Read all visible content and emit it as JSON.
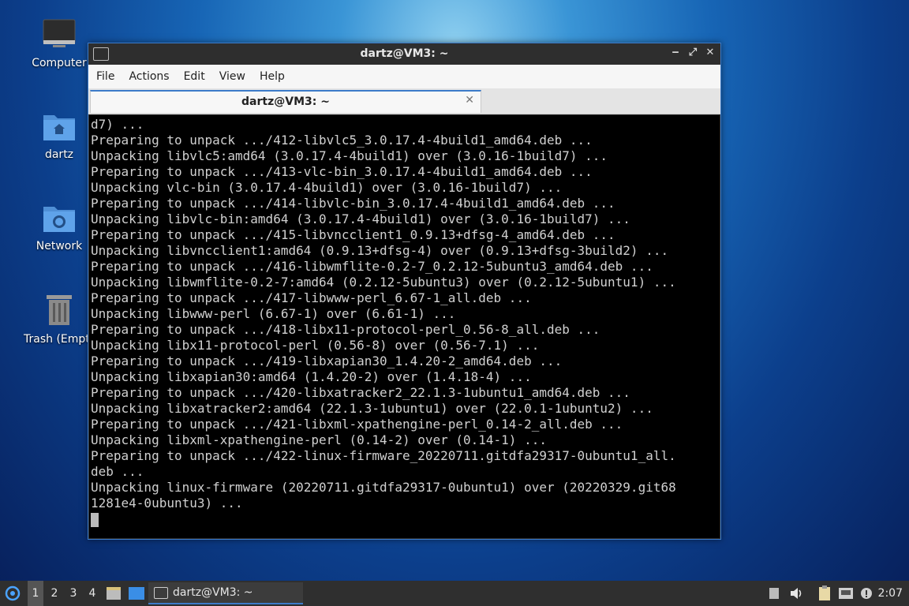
{
  "desktop": {
    "icons": [
      {
        "label": "Computer"
      },
      {
        "label": "dartz"
      },
      {
        "label": "Network"
      },
      {
        "label": "Trash (Empty)"
      }
    ]
  },
  "window": {
    "title": "dartz@VM3: ~",
    "menu": [
      "File",
      "Actions",
      "Edit",
      "View",
      "Help"
    ],
    "tab_label": "dartz@VM3: ~",
    "controls": {
      "minimize": "‒",
      "maximize": "⤢",
      "close": "✕"
    }
  },
  "terminal": {
    "lines": [
      "d7) ...",
      "Preparing to unpack .../412-libvlc5_3.0.17.4-4build1_amd64.deb ...",
      "Unpacking libvlc5:amd64 (3.0.17.4-4build1) over (3.0.16-1build7) ...",
      "Preparing to unpack .../413-vlc-bin_3.0.17.4-4build1_amd64.deb ...",
      "Unpacking vlc-bin (3.0.17.4-4build1) over (3.0.16-1build7) ...",
      "Preparing to unpack .../414-libvlc-bin_3.0.17.4-4build1_amd64.deb ...",
      "Unpacking libvlc-bin:amd64 (3.0.17.4-4build1) over (3.0.16-1build7) ...",
      "Preparing to unpack .../415-libvncclient1_0.9.13+dfsg-4_amd64.deb ...",
      "Unpacking libvncclient1:amd64 (0.9.13+dfsg-4) over (0.9.13+dfsg-3build2) ...",
      "Preparing to unpack .../416-libwmflite-0.2-7_0.2.12-5ubuntu3_amd64.deb ...",
      "Unpacking libwmflite-0.2-7:amd64 (0.2.12-5ubuntu3) over (0.2.12-5ubuntu1) ...",
      "Preparing to unpack .../417-libwww-perl_6.67-1_all.deb ...",
      "Unpacking libwww-perl (6.67-1) over (6.61-1) ...",
      "Preparing to unpack .../418-libx11-protocol-perl_0.56-8_all.deb ...",
      "Unpacking libx11-protocol-perl (0.56-8) over (0.56-7.1) ...",
      "Preparing to unpack .../419-libxapian30_1.4.20-2_amd64.deb ...",
      "Unpacking libxapian30:amd64 (1.4.20-2) over (1.4.18-4) ...",
      "Preparing to unpack .../420-libxatracker2_22.1.3-1ubuntu1_amd64.deb ...",
      "Unpacking libxatracker2:amd64 (22.1.3-1ubuntu1) over (22.0.1-1ubuntu2) ...",
      "Preparing to unpack .../421-libxml-xpathengine-perl_0.14-2_all.deb ...",
      "Unpacking libxml-xpathengine-perl (0.14-2) over (0.14-1) ...",
      "Preparing to unpack .../422-linux-firmware_20220711.gitdfa29317-0ubuntu1_all.",
      "deb ...",
      "Unpacking linux-firmware (20220711.gitdfa29317-0ubuntu1) over (20220329.git68",
      "1281e4-0ubuntu3) ..."
    ]
  },
  "panel": {
    "workspaces": [
      "1",
      "2",
      "3",
      "4"
    ],
    "active_workspace": "1",
    "task_label": "dartz@VM3: ~",
    "clock": "2:07",
    "icons": [
      "start-menu-icon",
      "file-manager-icon",
      "show-desktop-icon",
      "keyboard-icon",
      "volume-icon",
      "clipboard-icon",
      "network-icon",
      "notification-icon"
    ],
    "accent": "#3c7bc9"
  }
}
